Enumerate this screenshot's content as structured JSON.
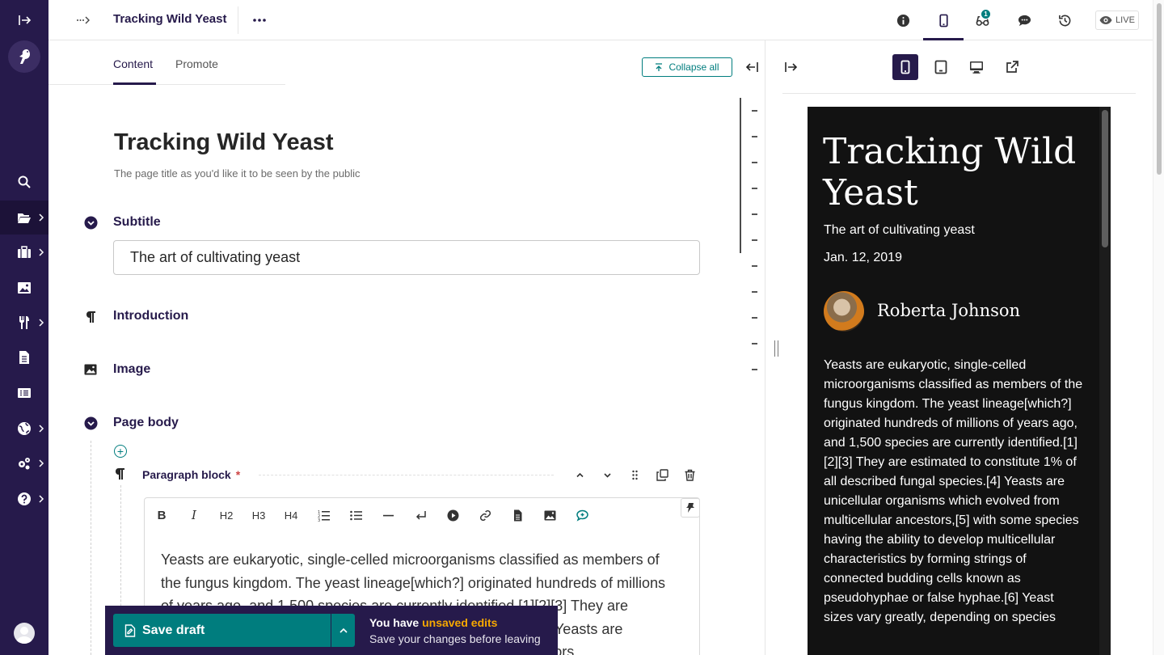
{
  "header": {
    "breadcrumb_icon": "ellipsis-arrow-icon",
    "title": "Tracking Wild Yeast",
    "notification_count": "1",
    "live_label": "LIVE"
  },
  "tabs": [
    {
      "label": "Content",
      "active": true
    },
    {
      "label": "Promote",
      "active": false
    }
  ],
  "editor": {
    "collapse_all": "Collapse all",
    "page_title": "Tracking Wild Yeast",
    "page_title_help": "The page title as you'd like it to be seen by the public",
    "sections": {
      "subtitle": "Subtitle",
      "introduction": "Introduction",
      "image": "Image",
      "page_body": "Page body"
    },
    "subtitle_value": "The art of cultivating yeast",
    "block": {
      "label": "Paragraph block",
      "required_mark": "*"
    },
    "toolbar": [
      "B",
      "I",
      "H2",
      "H3",
      "H4"
    ],
    "body_text": "Yeasts are eukaryotic, single-celled microorganisms classified as members of the fungus kingdom. The yeast lineage[which?] originated hundreds of millions of years ago, and 1,500 species are currently identified.[1][2][3] They are estimated to constitute 1% of all described fungal species.[4] Yeasts are unicellular organisms which evolved from multicellular ancestors,"
  },
  "savebar": {
    "save_label": "Save draft",
    "msg_prefix": "You have ",
    "msg_highlight": "unsaved edits",
    "msg_sub": "Save your changes before leaving"
  },
  "preview": {
    "title": "Tracking Wild Yeast",
    "subtitle": "The art of cultivating yeast",
    "date": "Jan. 12, 2019",
    "author": "Roberta Johnson",
    "body": "Yeasts are eukaryotic, single-celled microorganisms classified as members of the fungus kingdom. The yeast lineage[which?] originated hundreds of millions of years ago, and 1,500 species are currently identified.[1][2][3] They are estimated to constitute 1% of all described fungal species.[4] Yeasts are unicellular organisms which evolved from multicellular ancestors,[5] with some species having the ability to develop multicellular characteristics by forming strings of connected budding cells known as pseudohyphae or false hyphae.[6] Yeast sizes vary greatly, depending on species"
  },
  "colors": {
    "sidebar": "#261a4b",
    "accent": "#007d7e",
    "warning": "#f7a800",
    "preview_bg": "#121212"
  }
}
